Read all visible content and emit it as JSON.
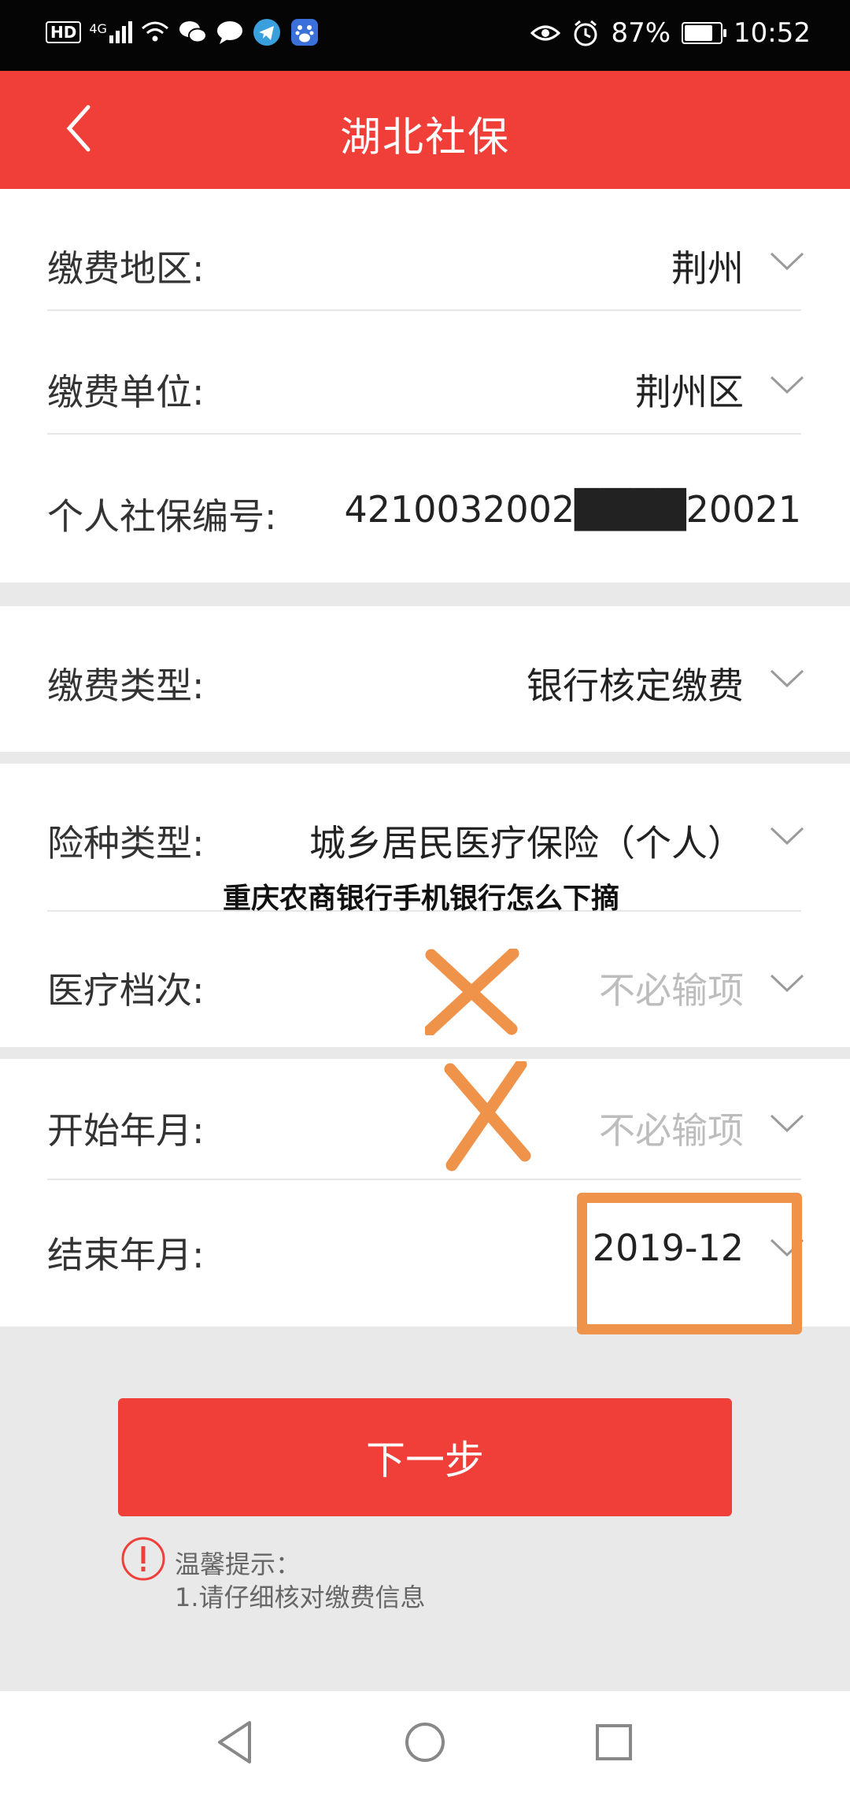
{
  "status_bar": {
    "network_label": "HD",
    "signal_label": "4G",
    "battery_percent": "87%",
    "battery_level": 0.87,
    "time": "10:52",
    "icons": [
      "hd-icon",
      "signal-icon",
      "wifi-icon",
      "wechat-icon",
      "chat-bubble-icon",
      "telegram-icon",
      "baidu-icon",
      "eye-icon",
      "alarm-icon",
      "battery-icon"
    ]
  },
  "header": {
    "title": "湖北社保",
    "back_icon": "chevron-left-icon"
  },
  "section1": {
    "rows": [
      {
        "label": "缴费地区:",
        "value": "荆州"
      },
      {
        "label": "缴费单位:",
        "value": "荆州区"
      },
      {
        "label": "个人社保编号:",
        "value": "4210032002████20021"
      }
    ]
  },
  "section2": {
    "rows": [
      {
        "label": "缴费类型:",
        "value": "银行核定缴费"
      }
    ]
  },
  "section3": {
    "rows": [
      {
        "label": "险种类型:",
        "value": "城乡居民医疗保险（个人）"
      },
      {
        "label": "医疗档次:",
        "value": "不必输项"
      }
    ]
  },
  "section4": {
    "rows": [
      {
        "label": "开始年月:",
        "value": "不必输项"
      },
      {
        "label": "结束年月:",
        "value": "2019-12"
      }
    ]
  },
  "overlay_caption": "重庆农商银行手机银行怎么下摘",
  "annotation_colors": {
    "cross": "#f0934a",
    "highlight": "#f0934a"
  },
  "theme": {
    "accent": "#ef3f38"
  },
  "next_button": {
    "label": "下一步"
  },
  "tips": {
    "title": "温馨提示：",
    "line1": "1.请仔细核对缴费信息"
  },
  "nav": {
    "back": "back-triangle-icon",
    "home": "home-circle-icon",
    "recents": "recents-square-icon"
  }
}
